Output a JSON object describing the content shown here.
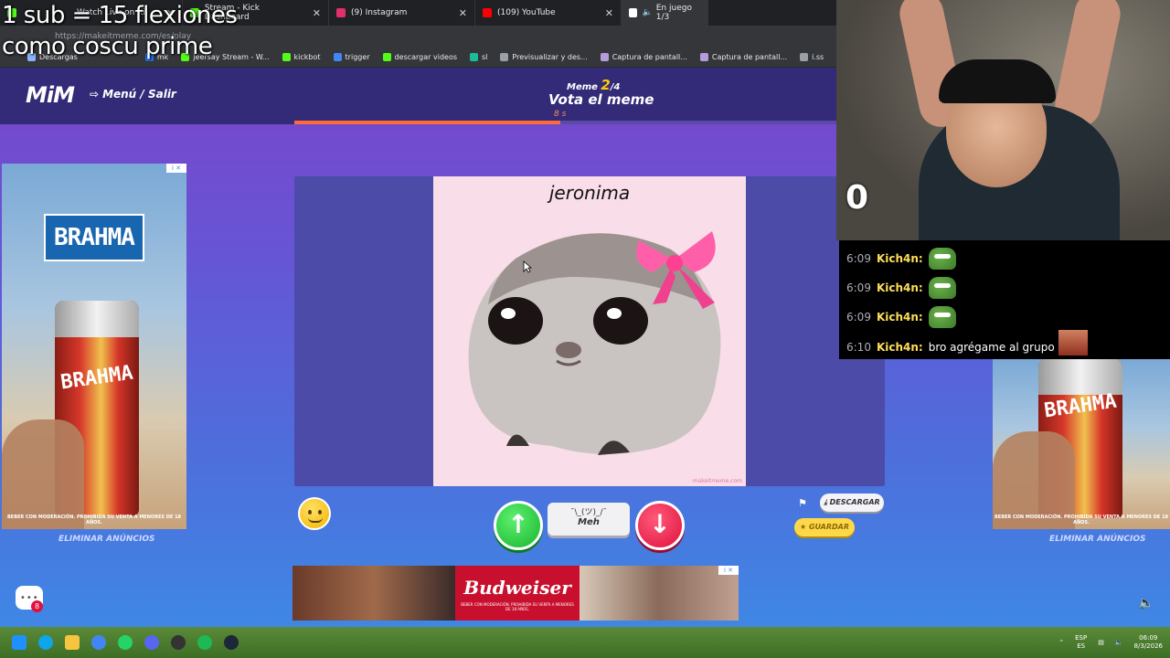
{
  "overlay": {
    "line1": "1 sub = 15 flexiones",
    "line2": "como coscu prime"
  },
  "browser": {
    "tabs": [
      {
        "label": "Watch Live on Ki",
        "fav": "#53fc18"
      },
      {
        "label": "Stream - Kick Dashboard",
        "fav": "#53fc18"
      },
      {
        "label": "(9) Instagram",
        "fav": "#e1306c"
      },
      {
        "label": "(109) YouTube",
        "fav": "#ff0000"
      },
      {
        "label": "En juego 1/3",
        "fav": "#ffffff"
      }
    ],
    "url": "https://makeitmeme.com/es/play",
    "bookmarks": [
      {
        "label": "Descargas",
        "fav": "#8ab4f8"
      },
      {
        "label": "mk",
        "fav": "#1877f2"
      },
      {
        "label": "jeersay Stream - W...",
        "fav": "#53fc18"
      },
      {
        "label": "kickbot",
        "fav": "#53fc18"
      },
      {
        "label": "trigger",
        "fav": "#4285f4"
      },
      {
        "label": "descargar videos",
        "fav": "#53fc18"
      },
      {
        "label": "sl",
        "fav": "#1abc9c"
      },
      {
        "label": "Previsualizar y des...",
        "fav": "#9aa0a6"
      },
      {
        "label": "Captura de pantall...",
        "fav": "#b39ddb"
      },
      {
        "label": "Captura de pantall...",
        "fav": "#b39ddb"
      },
      {
        "label": "i.ss",
        "fav": "#9aa0a6"
      }
    ]
  },
  "site": {
    "logo": "MiM",
    "menu_label": "Menú / Salir",
    "meme_label": "Meme",
    "meme_current": "2",
    "meme_total": "/4",
    "vote_title": "Vota el meme",
    "seconds": "8 s",
    "progress_fraction": 0.45,
    "meme_caption": "jeronima",
    "watermark": "makeitmeme.com",
    "meh_face": "¯\\_(ツ)_/¯",
    "meh_label": "Meh",
    "download_label": "DESCARGAR",
    "save_label": "GUARDAR",
    "remove_ads": "ELIMINAR ANÚNCIOS",
    "chat_badge": "8"
  },
  "ads": {
    "side_brand": "BRAHMA",
    "can_label": "BRAHMA",
    "side_warning": "BEBER CON MODERACIÓN. PROHIBIDA SU VENTA A MENORES DE 18 AÑOS.",
    "bottom_brand": "Budweiser",
    "bottom_warning": "BEBER CON MODERACIÓN. PROHIBIDA SU VENTA A MENORES DE 18 AÑOS.",
    "adchoice": "i ✕"
  },
  "stream": {
    "counter": "0",
    "chat": [
      {
        "time": "6:09",
        "user": "Kich4n:",
        "text": "",
        "emote": true
      },
      {
        "time": "6:09",
        "user": "Kich4n:",
        "text": "",
        "emote": true
      },
      {
        "time": "6:09",
        "user": "Kich4n:",
        "text": "",
        "emote": true
      },
      {
        "time": "6:10",
        "user": "Kich4n:",
        "text": "bro agrégame al grupo",
        "emote": false
      }
    ]
  },
  "taskbar": {
    "lang_top": "ESP",
    "lang_bottom": "ES",
    "time": "06:09",
    "date": "8/3/2026"
  }
}
